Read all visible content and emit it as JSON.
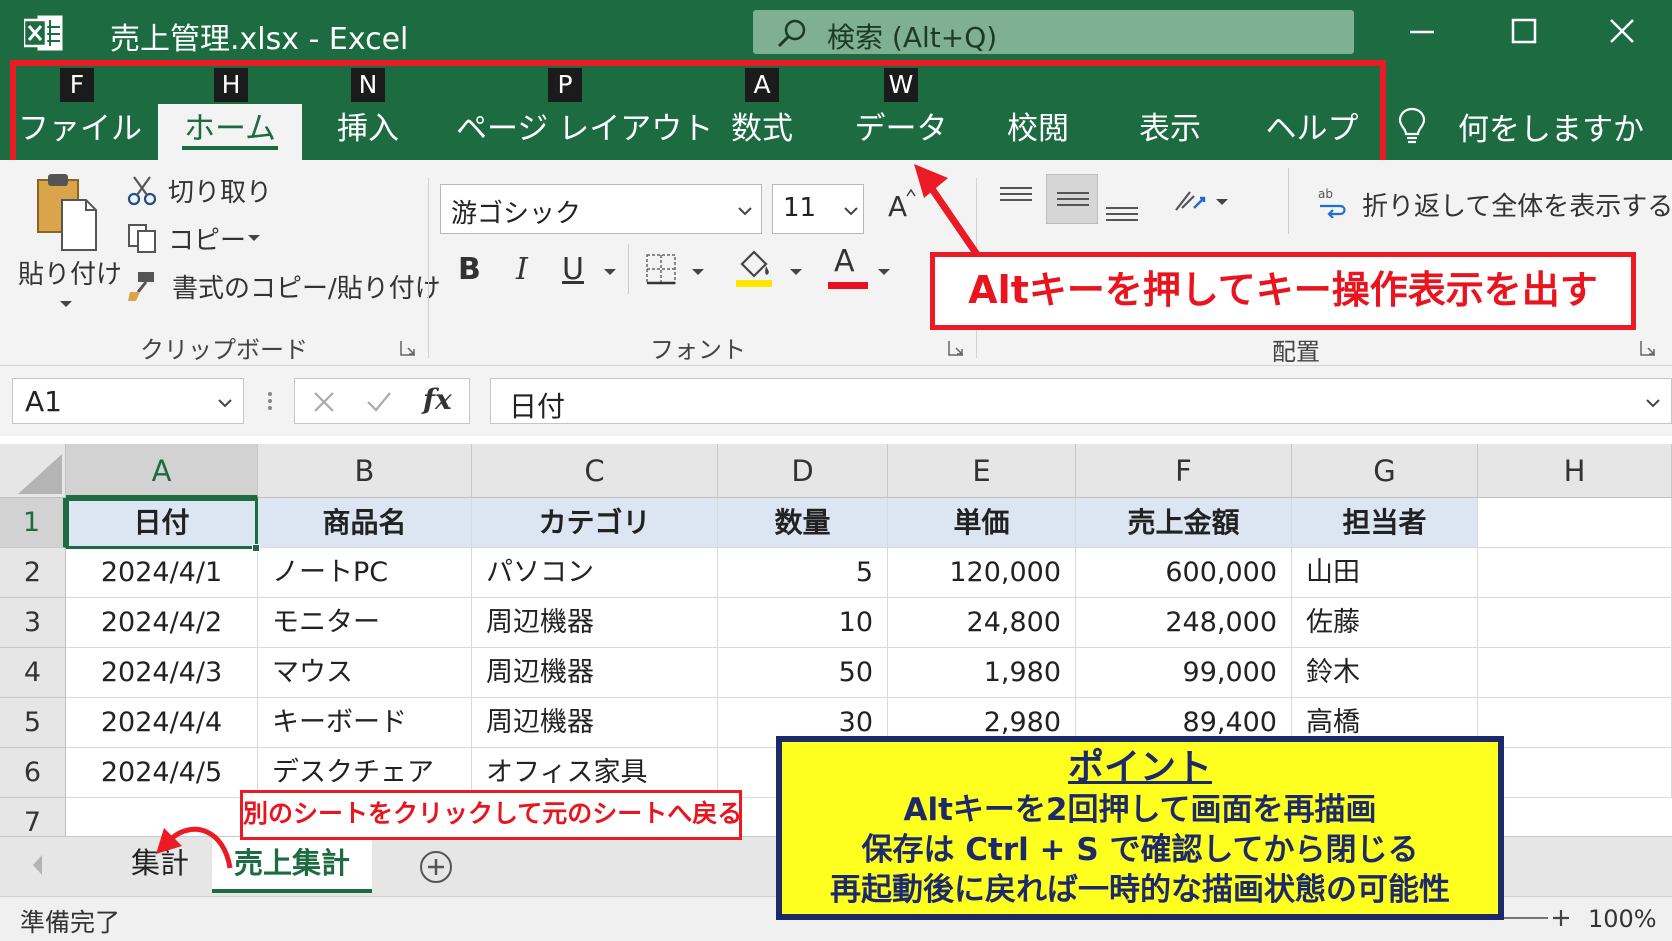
{
  "window": {
    "title": "売上管理.xlsx  -  Excel",
    "search_placeholder": "検索 (Alt+Q)",
    "controls": [
      "minimize",
      "maximize",
      "close"
    ]
  },
  "tabs": [
    {
      "label": "ファイル",
      "keytip": "F"
    },
    {
      "label": "ホーム",
      "keytip": "H",
      "active": true
    },
    {
      "label": "挿入",
      "keytip": "N"
    },
    {
      "label": "ページ レイアウト",
      "keytip": "P"
    },
    {
      "label": "数式",
      "keytip": "A"
    },
    {
      "label": "データ",
      "keytip": "W"
    },
    {
      "label": "校閲",
      "keytip": ""
    },
    {
      "label": "表示",
      "keytip": ""
    },
    {
      "label": "ヘルプ",
      "keytip": ""
    }
  ],
  "tell_me": "何をしますか",
  "ribbon": {
    "clipboard": {
      "paste": "貼り付け",
      "cut": "切り取り",
      "copy": "コピー",
      "format_painter": "書式のコピー/貼り付け",
      "group_label": "クリップボード"
    },
    "font": {
      "font_name": "游ゴシック",
      "font_size": "11",
      "bold": "B",
      "italic": "I",
      "underline": "U",
      "font_color_glyph": "A",
      "grow_glyph": "A",
      "group_label": "フォント",
      "fill_color": "#ffe600",
      "text_color": "#e81123"
    },
    "alignment": {
      "wrap_text": "折り返して全体を表示する",
      "group_label": "配置"
    }
  },
  "callouts": {
    "alt_key": "Altキーを押してキー操作表示を出す",
    "sheet_switch": "別のシートをクリックして元のシートへ戻る"
  },
  "formula_bar": {
    "name_box": "A1",
    "formula": "日付",
    "fx": "fx"
  },
  "grid": {
    "columns": [
      "A",
      "B",
      "C",
      "D",
      "E",
      "F",
      "G",
      "H"
    ],
    "row_numbers": [
      "1",
      "2",
      "3",
      "4",
      "5",
      "6",
      "7"
    ],
    "header_row": [
      "日付",
      "商品名",
      "カテゴリ",
      "数量",
      "単価",
      "売上金額",
      "担当者"
    ],
    "rows": [
      [
        "2024/4/1",
        "ノートPC",
        "パソコン",
        "5",
        "120,000",
        "600,000",
        "山田"
      ],
      [
        "2024/4/2",
        "モニター",
        "周辺機器",
        "10",
        "24,800",
        "248,000",
        "佐藤"
      ],
      [
        "2024/4/3",
        "マウス",
        "周辺機器",
        "50",
        "1,980",
        "99,000",
        "鈴木"
      ],
      [
        "2024/4/4",
        "キーボード",
        "周辺機器",
        "30",
        "2,980",
        "89,400",
        "高橋"
      ],
      [
        "2024/4/5",
        "デスクチェア",
        "オフィス家具",
        "",
        "",
        "",
        ""
      ]
    ]
  },
  "sheets": {
    "inactive": "集計",
    "active": "売上集計"
  },
  "status": {
    "ready": "準備完了",
    "zoom": "100%"
  },
  "point_box": {
    "title": "ポイント",
    "lines": [
      "Altキーを2回押して画面を再描画",
      "保存は Ctrl + S で確認してから閉じる",
      "再起動後に戻れば一時的な描画状態の可能性"
    ]
  },
  "colors": {
    "excel_green": "#1d6b40",
    "callout_red": "#ea1b25",
    "point_yellow": "#ffff1f",
    "point_navy": "#1c2a6b"
  }
}
